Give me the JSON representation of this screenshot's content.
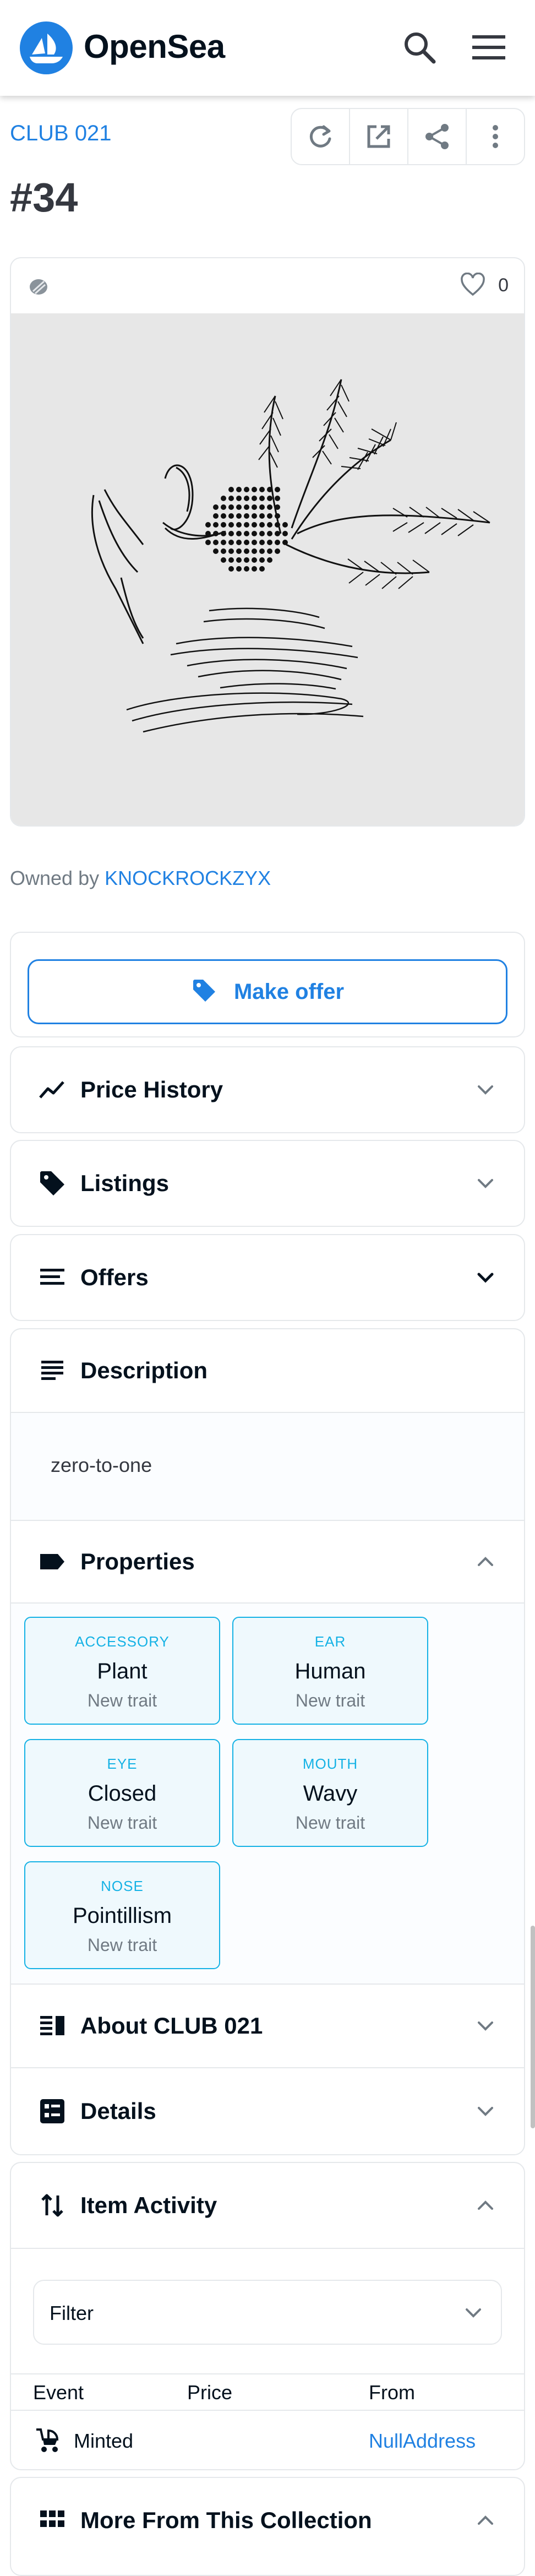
{
  "header": {
    "brand": "OpenSea",
    "icons": {
      "logo": "opensea-logo",
      "search": "search-icon",
      "menu": "hamburger-menu-icon"
    }
  },
  "collection": {
    "name": "CLUB 021"
  },
  "actions": [
    "refresh-icon",
    "external-link-icon",
    "share-icon",
    "more-vertical-icon"
  ],
  "token": {
    "title": "#34",
    "favorites": "0"
  },
  "owner": {
    "prefix": "Owned by",
    "name": "KNOCKROCKZYX"
  },
  "make_offer": {
    "label": "Make offer"
  },
  "sections": {
    "price_history": "Price History",
    "listings": "Listings",
    "offers": "Offers",
    "description": "Description",
    "properties": "Properties",
    "about": "About CLUB 021",
    "details": "Details",
    "item_activity": "Item Activity",
    "more_from_collection": "More From This Collection"
  },
  "description": {
    "text": "zero-to-one"
  },
  "properties": [
    {
      "type": "ACCESSORY",
      "value": "Plant",
      "rarity": "New trait"
    },
    {
      "type": "EAR",
      "value": "Human",
      "rarity": "New trait"
    },
    {
      "type": "EYE",
      "value": "Closed",
      "rarity": "New trait"
    },
    {
      "type": "MOUTH",
      "value": "Wavy",
      "rarity": "New trait"
    },
    {
      "type": "NOSE",
      "value": "Pointillism",
      "rarity": "New trait"
    }
  ],
  "activity": {
    "filter_label": "Filter",
    "columns": [
      "Event",
      "Price",
      "From"
    ],
    "rows": [
      {
        "event": "Minted",
        "price": "",
        "from": "NullAddress"
      }
    ]
  },
  "colors": {
    "accent": "#2081e2",
    "trait_border": "#15b2e5",
    "trait_bg": "#eff9fd",
    "text": "#04111d",
    "muted": "#707a83",
    "border": "#e5e8eb"
  }
}
